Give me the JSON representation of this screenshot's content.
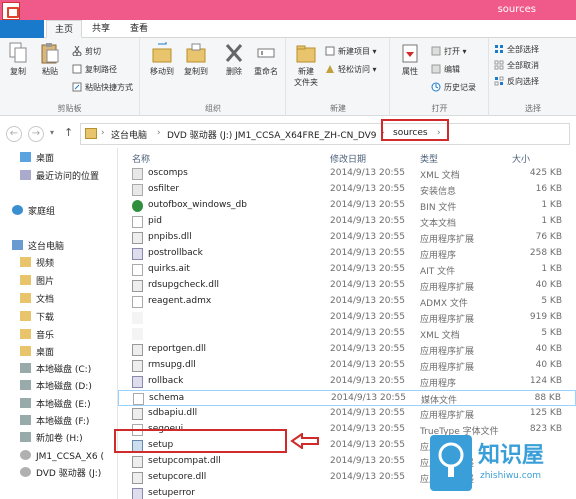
{
  "window": {
    "title": "sources"
  },
  "ribbon": {
    "tabs": [
      "主页",
      "共享",
      "查看"
    ],
    "groups": {
      "clipboard": {
        "label": "剪贴板",
        "copy": "复制",
        "paste": "粘贴",
        "cut": "剪切",
        "copy_path": "复制路径",
        "paste_shortcut": "粘贴快捷方式"
      },
      "organize": {
        "label": "组织",
        "move_to": "移动到",
        "copy_to": "复制到",
        "delete": "删除",
        "rename": "重命名"
      },
      "new": {
        "label": "新建",
        "new_folder": "新建\n文件夹",
        "new_item": "新建项目 ▾",
        "easy_access": "轻松访问 ▾"
      },
      "open": {
        "label": "打开",
        "properties": "属性",
        "open": "打开 ▾",
        "edit": "编辑",
        "history": "历史记录"
      },
      "select": {
        "label": "选择",
        "select_all": "全部选择",
        "select_none": "全部取消",
        "invert": "反向选择"
      }
    }
  },
  "address": {
    "crumbs": [
      "这台电脑",
      "DVD 驱动器 (J:) JM1_CCSA_X64FRE_ZH-CN_DV9",
      "sources"
    ]
  },
  "nav": {
    "items": [
      {
        "label": "桌面",
        "icon": "desktop-icon"
      },
      {
        "label": "最近访问的位置",
        "icon": "recent-icon"
      },
      {
        "label": "家庭组",
        "icon": "homegroup-icon"
      },
      {
        "label": "这台电脑",
        "icon": "computer-icon"
      },
      {
        "label": "视频",
        "icon": "video-folder-icon"
      },
      {
        "label": "图片",
        "icon": "pictures-folder-icon"
      },
      {
        "label": "文档",
        "icon": "documents-folder-icon"
      },
      {
        "label": "下载",
        "icon": "downloads-folder-icon"
      },
      {
        "label": "音乐",
        "icon": "music-folder-icon"
      },
      {
        "label": "桌面",
        "icon": "desktop-folder-icon"
      },
      {
        "label": "本地磁盘 (C:)",
        "icon": "drive-icon"
      },
      {
        "label": "本地磁盘 (D:)",
        "icon": "drive-icon"
      },
      {
        "label": "本地磁盘 (E:)",
        "icon": "drive-icon"
      },
      {
        "label": "本地磁盘 (F:)",
        "icon": "drive-icon"
      },
      {
        "label": "新加卷 (H:)",
        "icon": "drive-icon"
      },
      {
        "label": "JM1_CCSA_X6 (",
        "icon": "dvd-icon"
      },
      {
        "label": "DVD 驱动器 (J:)",
        "icon": "dvd-icon"
      }
    ]
  },
  "list": {
    "headers": {
      "name": "名称",
      "date": "修改日期",
      "type": "类型",
      "size": "大小"
    },
    "rows": [
      {
        "name": "oscomps",
        "date": "2014/9/13 20:55",
        "type": "XML 文档",
        "size": "425 KB"
      },
      {
        "name": "osfilter",
        "date": "2014/9/13 20:55",
        "type": "安装信息",
        "size": "16 KB"
      },
      {
        "name": "outofbox_windows_db",
        "date": "2014/9/13 20:55",
        "type": "BIN 文件",
        "size": "1 KB"
      },
      {
        "name": "pid",
        "date": "2014/9/13 20:55",
        "type": "文本文档",
        "size": "1 KB"
      },
      {
        "name": "pnpibs.dll",
        "date": "2014/9/13 20:55",
        "type": "应用程序扩展",
        "size": "76 KB"
      },
      {
        "name": "postrollback",
        "date": "2014/9/13 20:55",
        "type": "应用程序",
        "size": "258 KB"
      },
      {
        "name": "quirks.ait",
        "date": "2014/9/13 20:55",
        "type": "AIT 文件",
        "size": "1 KB"
      },
      {
        "name": "rdsupgcheck.dll",
        "date": "2014/9/13 20:55",
        "type": "应用程序扩展",
        "size": "40 KB"
      },
      {
        "name": "reagent.admx",
        "date": "2014/9/13 20:55",
        "type": "ADMX 文件",
        "size": "5 KB"
      },
      {
        "name": "",
        "date": "2014/9/13 20:55",
        "type": "应用程序扩展",
        "size": "919 KB"
      },
      {
        "name": "",
        "date": "2014/9/13 20:55",
        "type": "XML 文档",
        "size": "5 KB"
      },
      {
        "name": "reportgen.dll",
        "date": "2014/9/13 20:55",
        "type": "应用程序扩展",
        "size": "40 KB"
      },
      {
        "name": "rmsupg.dll",
        "date": "2014/9/13 20:55",
        "type": "应用程序扩展",
        "size": "40 KB"
      },
      {
        "name": "rollback",
        "date": "2014/9/13 20:55",
        "type": "应用程序",
        "size": "124 KB"
      },
      {
        "name": "schema",
        "date": "2014/9/13 20:55",
        "type": "媒体文件",
        "size": "88 KB"
      },
      {
        "name": "sdbapiu.dll",
        "date": "2014/9/13 20:55",
        "type": "应用程序扩展",
        "size": "125 KB"
      },
      {
        "name": "segoeui",
        "date": "2014/9/13 20:55",
        "type": "TrueType 字体文件",
        "size": "823 KB"
      },
      {
        "name": "setup",
        "date": "2014/9/13 20:55",
        "type": "应用程序",
        "size": ""
      },
      {
        "name": "setupcompat.dll",
        "date": "2014/9/13 20:55",
        "type": "应用程序扩展",
        "size": ""
      },
      {
        "name": "setupcore.dll",
        "date": "2014/9/13 20:55",
        "type": "应用程序扩展",
        "size": ""
      },
      {
        "name": "setuperror",
        "date": "",
        "type": "",
        "size": ""
      }
    ]
  },
  "watermark": {
    "brand": "知识屋",
    "url": "zhishiwu.com"
  },
  "colors": {
    "title_bar": "#f05a8a",
    "file_tab": "#1979ca",
    "highlight": "#d12a2a",
    "watermark": "#3a9fd8"
  }
}
